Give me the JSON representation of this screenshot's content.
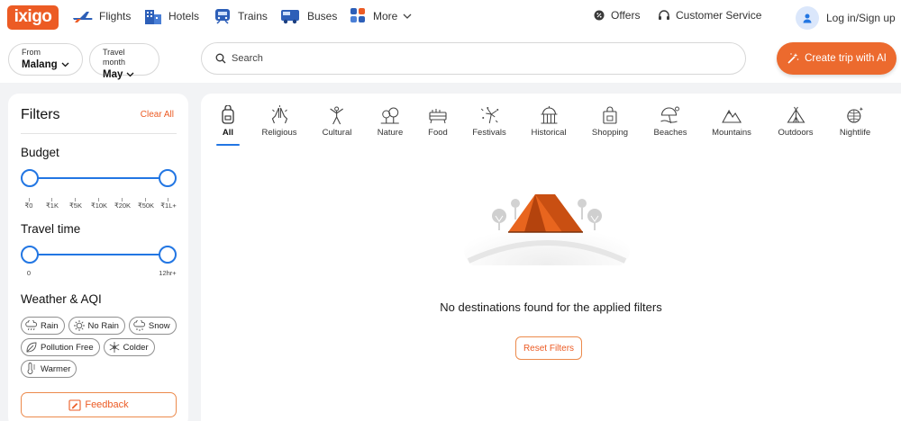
{
  "brand": {
    "logo_text": "ixigo",
    "accent": "#ec5b24",
    "slider_blue": "#2276e3"
  },
  "nav": [
    {
      "label": "Flights",
      "icon": "airplane-icon"
    },
    {
      "label": "Hotels",
      "icon": "hotel-icon"
    },
    {
      "label": "Trains",
      "icon": "train-icon"
    },
    {
      "label": "Buses",
      "icon": "bus-icon"
    },
    {
      "label": "More",
      "icon": "grid-icon"
    }
  ],
  "header_right": {
    "offers": "Offers",
    "customer_service": "Customer Service",
    "login": "Log in/Sign up"
  },
  "trip_bar": {
    "from_label": "From",
    "from_value": "Malang",
    "month_label": "Travel month",
    "month_value": "May",
    "search_placeholder": "Search",
    "cta_label": "Create trip with AI"
  },
  "filters": {
    "title": "Filters",
    "clear_all": "Clear All",
    "budget": {
      "title": "Budget",
      "ticks": [
        "₹0",
        "₹1K",
        "₹5K",
        "₹10K",
        "₹20K",
        "₹50K",
        "₹1L+"
      ],
      "selected_min": "₹0",
      "selected_max": "₹1L+"
    },
    "travel_time": {
      "title": "Travel time",
      "min_label": "0",
      "max_label": "12hr+"
    },
    "weather": {
      "title": "Weather & AQI",
      "chips": [
        {
          "label": "Rain",
          "icon": "rain-icon"
        },
        {
          "label": "No Rain",
          "icon": "sun-icon"
        },
        {
          "label": "Snow",
          "icon": "snow-icon"
        },
        {
          "label": "Pollution Free",
          "icon": "leaf-icon"
        },
        {
          "label": "Colder",
          "icon": "snowflake-icon"
        },
        {
          "label": "Warmer",
          "icon": "thermometer-icon"
        }
      ]
    },
    "feedback": "Feedback"
  },
  "categories": [
    {
      "label": "All",
      "icon": "backpack-icon",
      "active": true
    },
    {
      "label": "Religious",
      "icon": "praying-hands-icon"
    },
    {
      "label": "Cultural",
      "icon": "dancer-icon"
    },
    {
      "label": "Nature",
      "icon": "nature-icon"
    },
    {
      "label": "Food",
      "icon": "food-icon"
    },
    {
      "label": "Festivals",
      "icon": "fireworks-icon"
    },
    {
      "label": "Historical",
      "icon": "monument-icon"
    },
    {
      "label": "Shopping",
      "icon": "shopping-bag-icon"
    },
    {
      "label": "Beaches",
      "icon": "beach-icon"
    },
    {
      "label": "Mountains",
      "icon": "mountain-icon"
    },
    {
      "label": "Outdoors",
      "icon": "tent-outline-icon"
    },
    {
      "label": "Nightlife",
      "icon": "disco-ball-icon"
    }
  ],
  "empty_state": {
    "message": "No destinations found for the applied filters",
    "reset_label": "Reset Filters",
    "illustration": "tent-icon"
  }
}
